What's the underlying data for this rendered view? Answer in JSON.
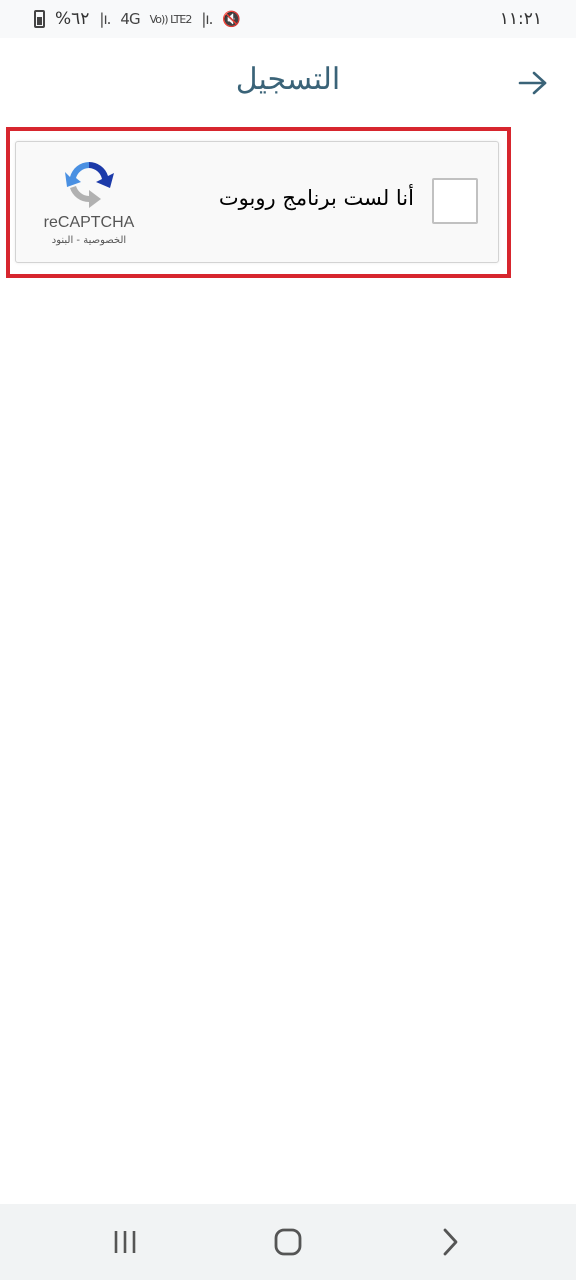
{
  "status_bar": {
    "time": "١١:٢١",
    "battery": "%٦٢",
    "network_4g": "4G",
    "network_lte": "Vo)) LTE2"
  },
  "header": {
    "title": "التسجيل",
    "back_icon": "arrow-right-icon"
  },
  "recaptcha": {
    "label": "أنا لست برنامج روبوت",
    "brand": "reCAPTCHA",
    "privacy": "الخصوصية",
    "separator": " - ",
    "terms": "البنود",
    "checked": false
  },
  "colors": {
    "title": "#3a6378",
    "highlight": "#d7262e",
    "logo_blue": "#1c3aa9",
    "logo_light_blue": "#4a90e2",
    "logo_gray": "#b1b1b1"
  },
  "nav_bar": {
    "recents_icon": "recents-icon",
    "home_icon": "home-icon",
    "back_icon": "back-chevron-icon"
  }
}
